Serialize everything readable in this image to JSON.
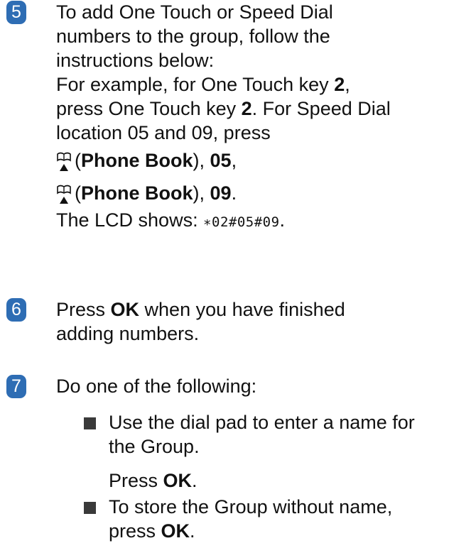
{
  "step5": {
    "number": "5",
    "line1": "To add One Touch or Speed Dial",
    "line2": "numbers to the group, follow the",
    "line3": "instructions below:",
    "line4_pre": "For example, for One Touch key ",
    "line4_bold": "2",
    "line4_post": ",",
    "line5_pre": "press One Touch key ",
    "line5_bold": "2",
    "line5_post": ". For Speed Dial",
    "line6": "location 05 and 09, press",
    "line7_open": "(",
    "line7_bold": "Phone Book",
    "line7_mid": "), ",
    "line7_num": "05",
    "line7_end": ",",
    "line8_open": "(",
    "line8_bold": "Phone Book",
    "line8_mid": "), ",
    "line8_num": "09",
    "line8_end": ".",
    "line9_pre": "The LCD shows: ",
    "line9_code": "∗02#05#09",
    "line9_end": ".",
    "icon": "phone-book-icon"
  },
  "step6": {
    "number": "6",
    "line1_pre": "Press ",
    "line1_bold": "OK",
    "line1_post": " when you have finished",
    "line2": "adding numbers."
  },
  "step7": {
    "number": "7",
    "line1": "Do one of the following:",
    "bullets": [
      {
        "line1": "Use the dial pad to enter a name for",
        "line2": "the Group.",
        "press_pre": "Press ",
        "press_bold": "OK",
        "press_post": "."
      },
      {
        "line1": "To store the Group without name,",
        "press_pre": "press ",
        "press_bold": "OK",
        "press_post": "."
      }
    ]
  },
  "colors": {
    "badge": "#2e6db4",
    "text": "#111111",
    "bullet": "#3a3a3a"
  }
}
